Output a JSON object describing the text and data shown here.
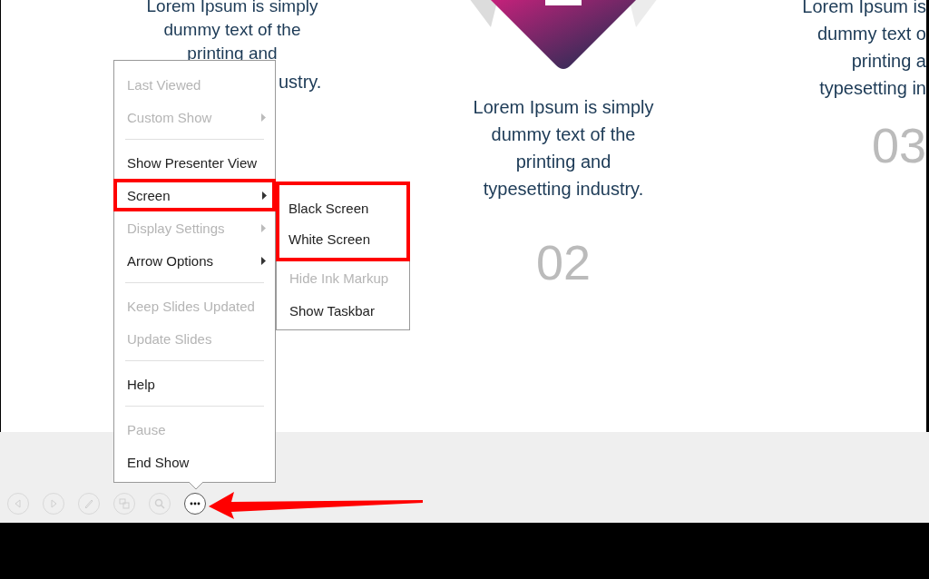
{
  "slide": {
    "left_column": [
      "Lorem Ipsum is simply",
      "dummy text of the",
      "printing and",
      "ustry."
    ],
    "middle_column": {
      "text": [
        "Lorem Ipsum is simply",
        "dummy text of the",
        "printing and",
        "typesetting industry."
      ],
      "number": "02"
    },
    "right_column": {
      "text": [
        "Lorem Ipsum is",
        "dummy text o",
        "printing a",
        "typesetting in"
      ],
      "number": "03"
    }
  },
  "menu": {
    "items": [
      {
        "kind": "item",
        "label": "Last Viewed",
        "disabled": true,
        "submenu": false,
        "highlighted": false
      },
      {
        "kind": "item",
        "label": "Custom Show",
        "disabled": true,
        "submenu": true,
        "highlighted": false
      },
      {
        "kind": "separator"
      },
      {
        "kind": "item",
        "label": "Show Presenter View",
        "disabled": false,
        "submenu": false,
        "highlighted": false
      },
      {
        "kind": "item",
        "label": "Screen",
        "disabled": false,
        "submenu": true,
        "highlighted": true
      },
      {
        "kind": "item",
        "label": "Display Settings",
        "disabled": true,
        "submenu": true,
        "highlighted": false
      },
      {
        "kind": "item",
        "label": "Arrow Options",
        "disabled": false,
        "submenu": true,
        "highlighted": false
      },
      {
        "kind": "separator"
      },
      {
        "kind": "item",
        "label": "Keep Slides Updated",
        "disabled": true,
        "submenu": false,
        "highlighted": false
      },
      {
        "kind": "item",
        "label": "Update Slides",
        "disabled": true,
        "submenu": false,
        "highlighted": false
      },
      {
        "kind": "separator"
      },
      {
        "kind": "item",
        "label": "Help",
        "disabled": false,
        "submenu": false,
        "highlighted": false
      },
      {
        "kind": "separator"
      },
      {
        "kind": "item",
        "label": "Pause",
        "disabled": true,
        "submenu": false,
        "highlighted": false
      },
      {
        "kind": "item",
        "label": "End Show",
        "disabled": false,
        "submenu": false,
        "highlighted": false
      }
    ]
  },
  "submenu": {
    "items": [
      {
        "label": "Black Screen",
        "disabled": false,
        "highlighted": true
      },
      {
        "label": "White Screen",
        "disabled": false,
        "highlighted": true
      },
      {
        "label": "Hide Ink Markup",
        "disabled": true,
        "highlighted": false
      },
      {
        "label": "Show Taskbar",
        "disabled": false,
        "highlighted": false
      }
    ]
  },
  "toolbar": [
    {
      "kind": "previous",
      "active": false
    },
    {
      "kind": "next",
      "active": false
    },
    {
      "kind": "pen",
      "active": false
    },
    {
      "kind": "slides",
      "active": false
    },
    {
      "kind": "zoom",
      "active": false
    },
    {
      "kind": "more",
      "active": true
    }
  ],
  "pointer_arrow": true
}
